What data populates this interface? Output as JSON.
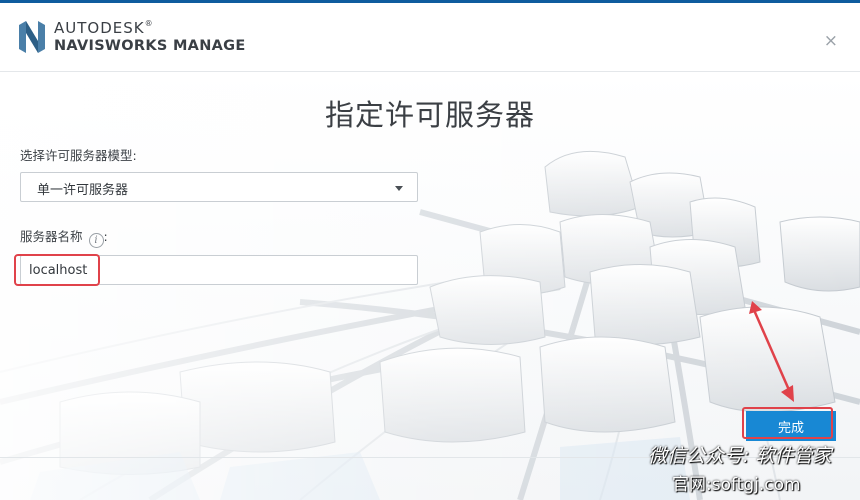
{
  "header": {
    "brand_line1": "AUTODESK",
    "brand_line2": "NAVISWORKS MANAGE",
    "registered": "®",
    "close_glyph": "×"
  },
  "page_title": "指定许可服务器",
  "model": {
    "label": "选择许可服务器模型:",
    "selected": "单一许可服务器"
  },
  "server": {
    "label": "服务器名称",
    "label_suffix": ":",
    "info_glyph": "i",
    "value": "localhost"
  },
  "finish_button": "完成",
  "watermark": {
    "line1": "微信公众号: 软件管家",
    "line2": "官网:softgj.com"
  },
  "colors": {
    "accent": "#1888d4",
    "highlight": "#e0424a",
    "topbar": "#0f5c9e"
  }
}
